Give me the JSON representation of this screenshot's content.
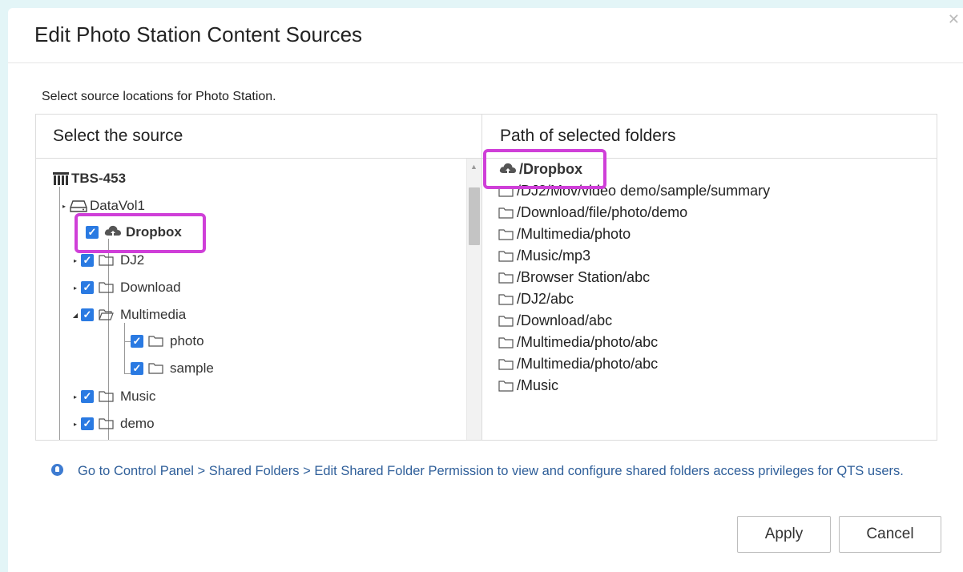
{
  "dialog": {
    "title": "Edit Photo Station Content Sources",
    "subtitle": "Select source locations for Photo Station."
  },
  "left_panel": {
    "header": "Select the source",
    "tree": {
      "root": "TBS-453",
      "volume": "DataVol1",
      "items": [
        {
          "label": "Dropbox",
          "checked": true,
          "icon": "cloud-upload-icon",
          "highlighted": true
        },
        {
          "label": "DJ2",
          "checked": true,
          "icon": "folder-icon"
        },
        {
          "label": "Download",
          "checked": true,
          "icon": "folder-icon"
        },
        {
          "label": "Multimedia",
          "checked": true,
          "icon": "folder-open-icon",
          "expanded": true
        },
        {
          "label": "photo",
          "checked": true,
          "icon": "folder-icon"
        },
        {
          "label": "sample",
          "checked": true,
          "icon": "folder-icon"
        },
        {
          "label": "Music",
          "checked": true,
          "icon": "folder-icon"
        },
        {
          "label": "demo",
          "checked": true,
          "icon": "folder-icon"
        }
      ]
    }
  },
  "right_panel": {
    "header": "Path of selected folders",
    "paths": [
      {
        "label": "/Dropbox",
        "icon": "cloud-upload-icon",
        "highlighted": true
      },
      {
        "label": "/DJ2/Mov/video demo/sample/summary",
        "icon": "folder-icon"
      },
      {
        "label": "/Download/file/photo/demo",
        "icon": "folder-icon"
      },
      {
        "label": "/Multimedia/photo",
        "icon": "folder-icon"
      },
      {
        "label": "/Music/mp3",
        "icon": "folder-icon"
      },
      {
        "label": "/Browser Station/abc",
        "icon": "folder-icon"
      },
      {
        "label": "/DJ2/abc",
        "icon": "folder-icon"
      },
      {
        "label": "/Download/abc",
        "icon": "folder-icon"
      },
      {
        "label": "/Multimedia/photo/abc",
        "icon": "folder-icon"
      },
      {
        "label": "/Multimedia/photo/abc",
        "icon": "folder-icon"
      },
      {
        "label": "/Music",
        "icon": "folder-icon"
      }
    ]
  },
  "info": {
    "text": "Go to Control Panel > Shared Folders > Edit Shared Folder Permission to view and configure shared folders access privileges for QTS users."
  },
  "buttons": {
    "apply": "Apply",
    "cancel": "Cancel"
  },
  "colors": {
    "highlight": "#cf3fd8",
    "checkbox": "#2a7ae2",
    "info_text": "#2f5f9a"
  }
}
